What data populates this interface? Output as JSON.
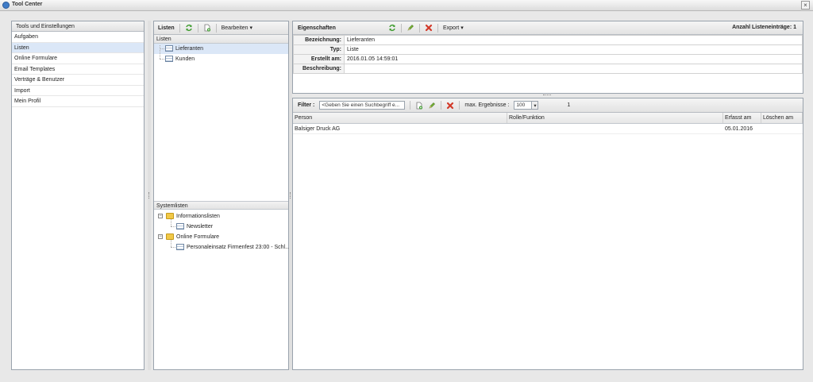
{
  "window": {
    "title": "Tool Center"
  },
  "nav": {
    "header": "Tools und Einstellungen",
    "items": [
      {
        "label": "Aufgaben",
        "selected": false
      },
      {
        "label": "Listen",
        "selected": true
      },
      {
        "label": "Online Formulare",
        "selected": false
      },
      {
        "label": "Email Templates",
        "selected": false
      },
      {
        "label": "Verträge & Benutzer",
        "selected": false
      },
      {
        "label": "Import",
        "selected": false
      },
      {
        "label": "Mein Profil",
        "selected": false
      }
    ]
  },
  "lists": {
    "toolbar": {
      "title": "Listen",
      "edit_label": "Bearbeiten"
    },
    "section_label": "Listen",
    "items": [
      {
        "label": "Lieferanten",
        "selected": true
      },
      {
        "label": "Kunden",
        "selected": false
      }
    ]
  },
  "system_lists": {
    "section_label": "Systemlisten",
    "groups": [
      {
        "label": "Informationslisten",
        "children": [
          "Newsletter"
        ]
      },
      {
        "label": "Online Formulare",
        "children": [
          "Personaleinsatz Firmenfest 23:00 - Schl..."
        ]
      }
    ]
  },
  "properties": {
    "title": "Eigenschaften",
    "export_label": "Export",
    "count_label": "Anzahl Listeneinträge: 1",
    "fields": [
      {
        "key": "Bezeichnung:",
        "value": "Lieferanten"
      },
      {
        "key": "Typ:",
        "value": "Liste"
      },
      {
        "key": "Erstellt am:",
        "value": "2016.01.05 14:59:01"
      },
      {
        "key": "Beschreibung:",
        "value": ""
      }
    ]
  },
  "results": {
    "filter_label": "Filter :",
    "search_placeholder": "<Geben Sie einen Suchbegriff e...",
    "max_label": "max. Ergebnisse :",
    "max_value": "100",
    "page": "1",
    "columns": [
      "Person",
      "Rolle/Funktion",
      "Erfasst am",
      "Löschen am"
    ],
    "rows": [
      [
        "Balsiger Druck AG",
        "",
        "05.01.2016",
        ""
      ]
    ]
  },
  "colors": {
    "selection": "#dbe7f7",
    "border": "#9aa3ad",
    "accent": "#3f7cc7"
  }
}
